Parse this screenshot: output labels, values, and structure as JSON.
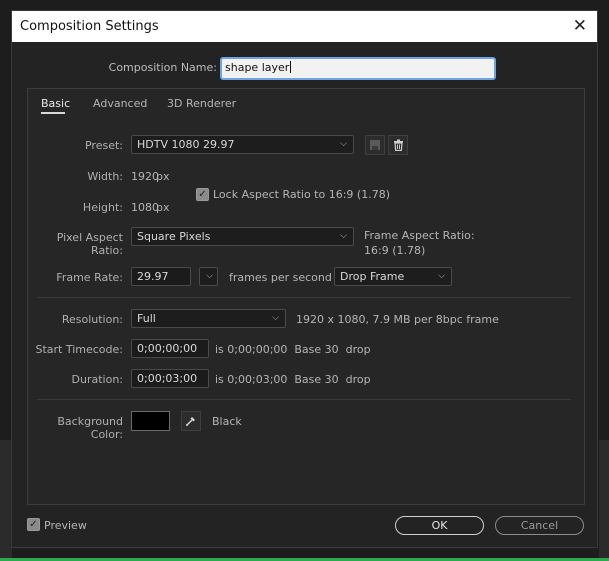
{
  "dialog": {
    "title": "Composition Settings",
    "close_glyph": "✕"
  },
  "name_field": {
    "label": "Composition Name:",
    "value": "shape layer"
  },
  "tabs": [
    {
      "label": "Basic",
      "active": true
    },
    {
      "label": "Advanced",
      "active": false
    },
    {
      "label": "3D Renderer",
      "active": false
    }
  ],
  "basic": {
    "preset_label": "Preset:",
    "preset_value": "HDTV 1080 29.97",
    "width_label": "Width:",
    "width_value": "1920",
    "width_unit": "px",
    "height_label": "Height:",
    "height_value": "1080",
    "height_unit": "px",
    "lock_aspect_label": "Lock Aspect Ratio to 16:9 (1.78)",
    "lock_aspect_checked": true,
    "par_label": "Pixel Aspect Ratio:",
    "par_value": "Square Pixels",
    "frame_aspect_label": "Frame Aspect Ratio:",
    "frame_aspect_value": "16:9 (1.78)",
    "frame_rate_label": "Frame Rate:",
    "frame_rate_value": "29.97",
    "frame_rate_unit": "frames per second",
    "drop_frame_value": "Drop Frame",
    "resolution_label": "Resolution:",
    "resolution_value": "Full",
    "resolution_info": "1920 x 1080, 7.9 MB per 8bpc frame",
    "start_tc_label": "Start Timecode:",
    "start_tc_value": "0;00;00;00",
    "start_tc_info": "is 0;00;00;00  Base 30  drop",
    "duration_label": "Duration:",
    "duration_value": "0;00;03;00",
    "duration_info": "is 0;00;03;00  Base 30  drop",
    "bg_color_label": "Background Color:",
    "bg_color_name": "Black",
    "bg_color_hex": "#000000"
  },
  "footer": {
    "preview_label": "Preview",
    "preview_checked": true,
    "ok_label": "OK",
    "cancel_label": "Cancel"
  },
  "colors": {
    "accent_blue": "#3d8ee6",
    "focus_ring": "#6ea5e0",
    "green_indicator": "#2fa84f"
  },
  "icons": [
    "close-icon",
    "chevron-down-icon",
    "save-preset-icon",
    "trash-icon",
    "checkmark-icon",
    "eyedropper-icon"
  ]
}
